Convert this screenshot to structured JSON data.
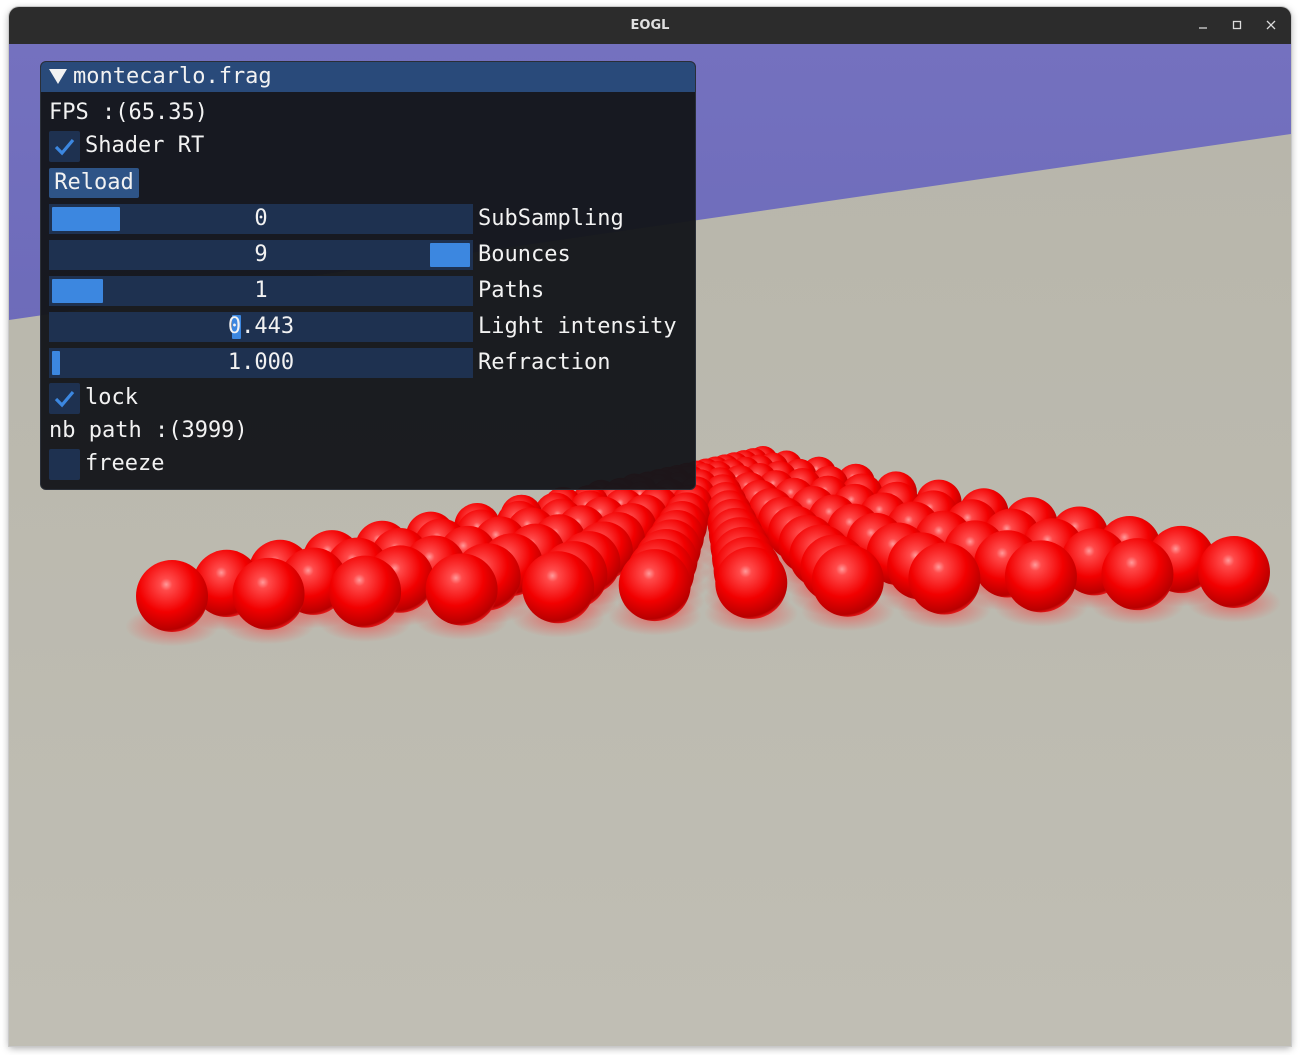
{
  "window": {
    "title": "EOGL",
    "controls": {
      "minimize": "–",
      "maximize": "□",
      "close": "×"
    }
  },
  "panel": {
    "title": "montecarlo.frag",
    "fps_text": "FPS :(65.35)",
    "shader_rt": {
      "label": "Shader RT",
      "checked": true
    },
    "reload_label": "Reload",
    "sliders": [
      {
        "label": "SubSampling",
        "value_text": "0",
        "level": 0.0
      },
      {
        "label": "Bounces",
        "value_text": "9",
        "level": 1.0
      },
      {
        "label": "Paths",
        "value_text": "1",
        "level": 0.0
      },
      {
        "label": "Light intensity",
        "value_text": "0.443",
        "level": 0.44
      },
      {
        "label": "Refraction",
        "value_text": "1.000",
        "level": 0.0
      }
    ],
    "lock": {
      "label": "lock",
      "checked": true
    },
    "nb_path_text": "nb path :(3999)",
    "freeze": {
      "label": "freeze",
      "checked": false
    }
  },
  "colors": {
    "title_bar_active": "#294a7a",
    "slider_frame": "#1e3150",
    "slider_grab": "#3c87e0",
    "check_mark": "#3c87e0",
    "sky": "#6b6cb8",
    "floor": "#bebcb2",
    "spheres": "#ff0000"
  },
  "icons": [
    "collapse-arrow-icon",
    "checkmark-icon",
    "minimize-icon",
    "maximize-icon",
    "close-icon"
  ]
}
